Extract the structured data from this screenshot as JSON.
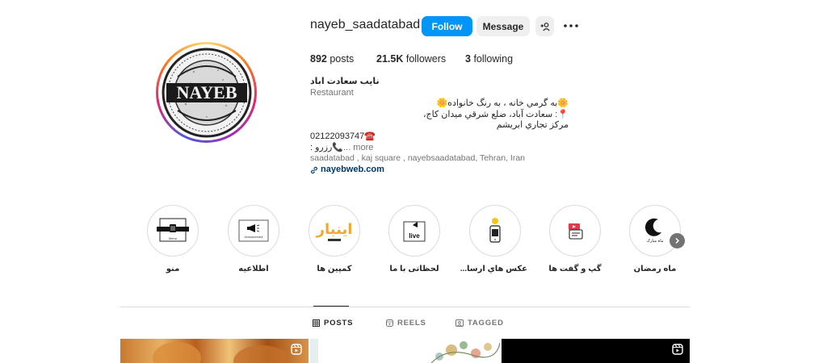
{
  "profile": {
    "username": "nayeb_saadatabad",
    "avatar_logo_text": "NAYEB",
    "follow_label": "Follow",
    "message_label": "Message"
  },
  "stats": {
    "posts_count": "892",
    "posts_label": "posts",
    "followers_count": "21.5K",
    "followers_label": "followers",
    "following_count": "3",
    "following_label": "following"
  },
  "bio": {
    "name": "نایب سعادت اباد",
    "category": "Restaurant",
    "line1": "🌼به گرمي خانه ، به رنگ خانواده🌼",
    "line2": "📍: سعادت آباد، ضلع شرقي ميدان كاج،",
    "line3": "مركز تجاري ابريشم",
    "line4": "02122093747☎️",
    "line5": "رزرو📞",
    "line5_prefix": ": ",
    "more": "... more",
    "address": "saadatabad , kaj square , nayebsaadatabad, Tehran, Iran",
    "link": "nayebweb.com"
  },
  "highlights": [
    {
      "label": "منو",
      "icon": "menu-board-icon",
      "inner_text": "Menu"
    },
    {
      "label": "اطلاعیه",
      "icon": "megaphone-icon",
      "inner_text": "Announcement"
    },
    {
      "label": "کمپین ها",
      "icon": "campaign-logo-icon",
      "inner_text": "اینبار"
    },
    {
      "label": "لحظاتی با ما",
      "icon": "live-icon",
      "inner_text": "live"
    },
    {
      "label": "عکس هاي ارسا...",
      "icon": "phone-camera-icon",
      "inner_text": ""
    },
    {
      "label": "گپ و گفت ها",
      "icon": "chat-icon",
      "inner_text": ""
    },
    {
      "label": "ماه رمضان",
      "icon": "crescent-moon-icon",
      "inner_text": "ماه مبارک"
    }
  ],
  "tabs": {
    "posts": "POSTS",
    "reels": "REELS",
    "tagged": "TAGGED"
  },
  "colors": {
    "follow_button": "#0095f6",
    "link": "#00376b"
  }
}
